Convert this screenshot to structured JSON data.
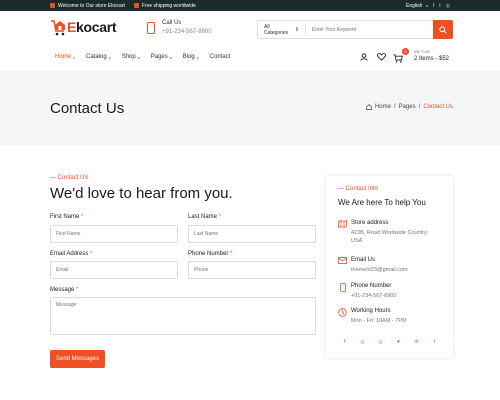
{
  "topbar": {
    "welcome": "Welcome to Our store Ekocart",
    "shipping": "Free shipping worldwide",
    "language": "English",
    "socials": [
      "facebook-icon",
      "twitter-icon",
      "instagram-icon"
    ]
  },
  "brand": {
    "accent": "#f04e23",
    "dark": "#1c2b2a"
  },
  "logo": {
    "first": "E",
    "rest": "kocart"
  },
  "callus": {
    "title": "Call Us",
    "number": "+91-234-567-8900"
  },
  "search": {
    "category": "All Categories",
    "placeholder": "Enter Your Keyword"
  },
  "nav": {
    "items": [
      {
        "label": "Home",
        "dropdown": true
      },
      {
        "label": "Catalog",
        "dropdown": true
      },
      {
        "label": "Shop",
        "dropdown": true
      },
      {
        "label": "Pages",
        "dropdown": true
      },
      {
        "label": "Blog",
        "dropdown": true
      },
      {
        "label": "Contact",
        "dropdown": false
      }
    ],
    "caret": "v"
  },
  "cart": {
    "count": "0",
    "label": "My Cart",
    "summary": "2 Items - $52"
  },
  "hero": {
    "title": "Contact Us",
    "breadcrumb": [
      "Home",
      "/",
      "Pages",
      "/",
      "Contact Us"
    ]
  },
  "form": {
    "kicker": "— Contact US",
    "title": "We'd love to hear from you.",
    "required_mark": "*",
    "first_name": {
      "label": "First Name",
      "placeholder": "First Name"
    },
    "last_name": {
      "label": "Last Name",
      "placeholder": "Last Name"
    },
    "email": {
      "label": "Email Address",
      "placeholder": "Email"
    },
    "phone": {
      "label": "Phone Number",
      "placeholder": "Phone"
    },
    "message": {
      "label": "Message",
      "placeholder": "Message"
    },
    "submit": "Send Messages"
  },
  "info": {
    "kicker": "— Contact Info",
    "title": "We Are here To help You",
    "address": {
      "label": "Store address",
      "line1": "423B, Road Wordwide Country,",
      "line2": "USA"
    },
    "email": {
      "label": "Email Us",
      "value": "themeht23@gmail.com"
    },
    "phone": {
      "label": "Phone Number",
      "value": "+91-234-567-8900"
    },
    "hours": {
      "label": "Working Hours",
      "value": "Mon - Fri: 10AM - 7PM"
    },
    "socials": [
      "f",
      "◎",
      "◎",
      "♥",
      "in",
      "t"
    ]
  }
}
